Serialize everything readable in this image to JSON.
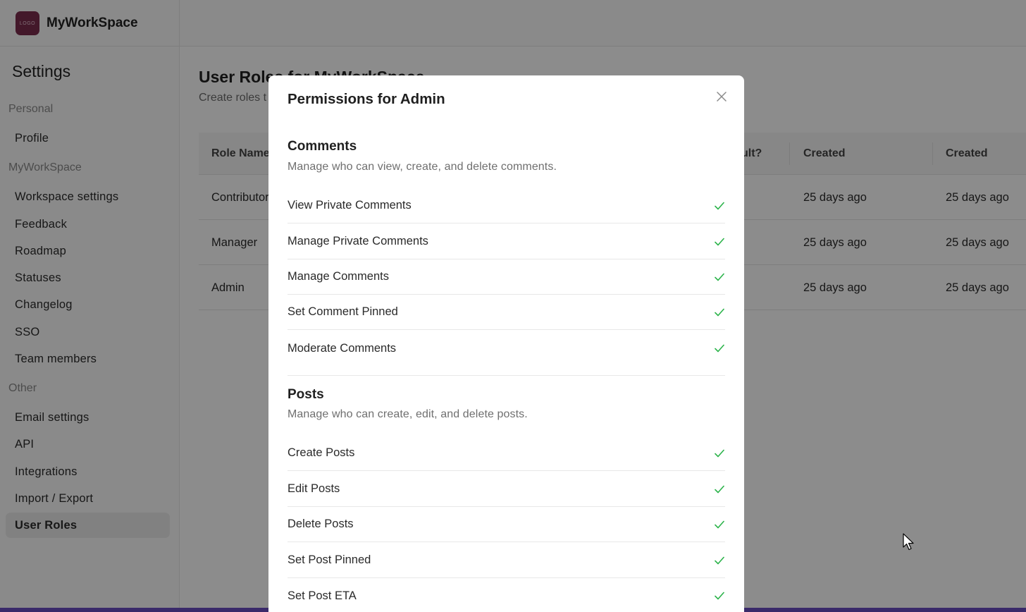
{
  "brand": {
    "name": "MyWorkSpace",
    "logo_text": "LOGO"
  },
  "sidebar": {
    "title": "Settings",
    "groups": [
      {
        "label": "Personal"
      },
      {
        "label": "MyWorkSpace"
      },
      {
        "label": "Other"
      }
    ],
    "items": [
      {
        "label": "Profile"
      },
      {
        "label": "Workspace settings"
      },
      {
        "label": "Feedback"
      },
      {
        "label": "Roadmap"
      },
      {
        "label": "Statuses"
      },
      {
        "label": "Changelog"
      },
      {
        "label": "SSO"
      },
      {
        "label": "Team members"
      },
      {
        "label": "Email settings"
      },
      {
        "label": "API"
      },
      {
        "label": "Integrations"
      },
      {
        "label": "Import / Export"
      },
      {
        "label": "User Roles"
      }
    ]
  },
  "main": {
    "title": "User Roles for MyWorkSpace",
    "subtitle": "Create roles t",
    "table": {
      "headers": [
        "Role Name",
        "ult?",
        "Created",
        "Created"
      ],
      "rows": [
        {
          "name": "Contributor",
          "created": "25 days ago",
          "updated": "25 days ago"
        },
        {
          "name": "Manager",
          "created": "25 days ago",
          "updated": "25 days ago"
        },
        {
          "name": "Admin",
          "created": "25 days ago",
          "updated": "25 days ago"
        }
      ]
    }
  },
  "modal": {
    "title": "Permissions for Admin",
    "sections": [
      {
        "title": "Comments",
        "description": "Manage who can view, create, and delete comments.",
        "permissions": [
          {
            "label": "View Private Comments"
          },
          {
            "label": "Manage Private Comments"
          },
          {
            "label": "Manage Comments"
          },
          {
            "label": "Set Comment Pinned"
          },
          {
            "label": "Moderate Comments"
          }
        ]
      },
      {
        "title": "Posts",
        "description": "Manage who can create, edit, and delete posts.",
        "permissions": [
          {
            "label": "Create Posts"
          },
          {
            "label": "Edit Posts"
          },
          {
            "label": "Delete Posts"
          },
          {
            "label": "Set Post Pinned"
          },
          {
            "label": "Set Post ETA"
          }
        ]
      }
    ]
  },
  "colors": {
    "check": "#2bb34a",
    "overlay": "rgba(0,0,0,0.45)",
    "logo_bg": "#7a2c4e",
    "bottom_bar": "#3a2a6a"
  },
  "icons": {
    "close": "close-icon",
    "check": "check-icon",
    "cursor": "mouse-cursor-icon"
  }
}
